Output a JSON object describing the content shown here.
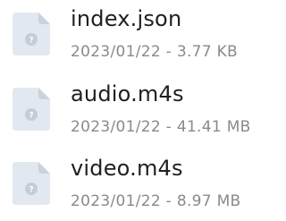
{
  "colors": {
    "icon_body": "#e2e8ef",
    "icon_fold": "#c9d3de",
    "icon_badge": "#c2cdd9",
    "name_text": "#1f1f1f",
    "meta_text": "#8a8a8a"
  },
  "files": [
    {
      "icon": "unknown-file-icon",
      "name": "index.json",
      "meta": "2023/01/22 - 3.77 KB"
    },
    {
      "icon": "unknown-file-icon",
      "name": "audio.m4s",
      "meta": "2023/01/22 - 41.41 MB"
    },
    {
      "icon": "unknown-file-icon",
      "name": "video.m4s",
      "meta": "2023/01/22 - 8.97 MB"
    }
  ]
}
